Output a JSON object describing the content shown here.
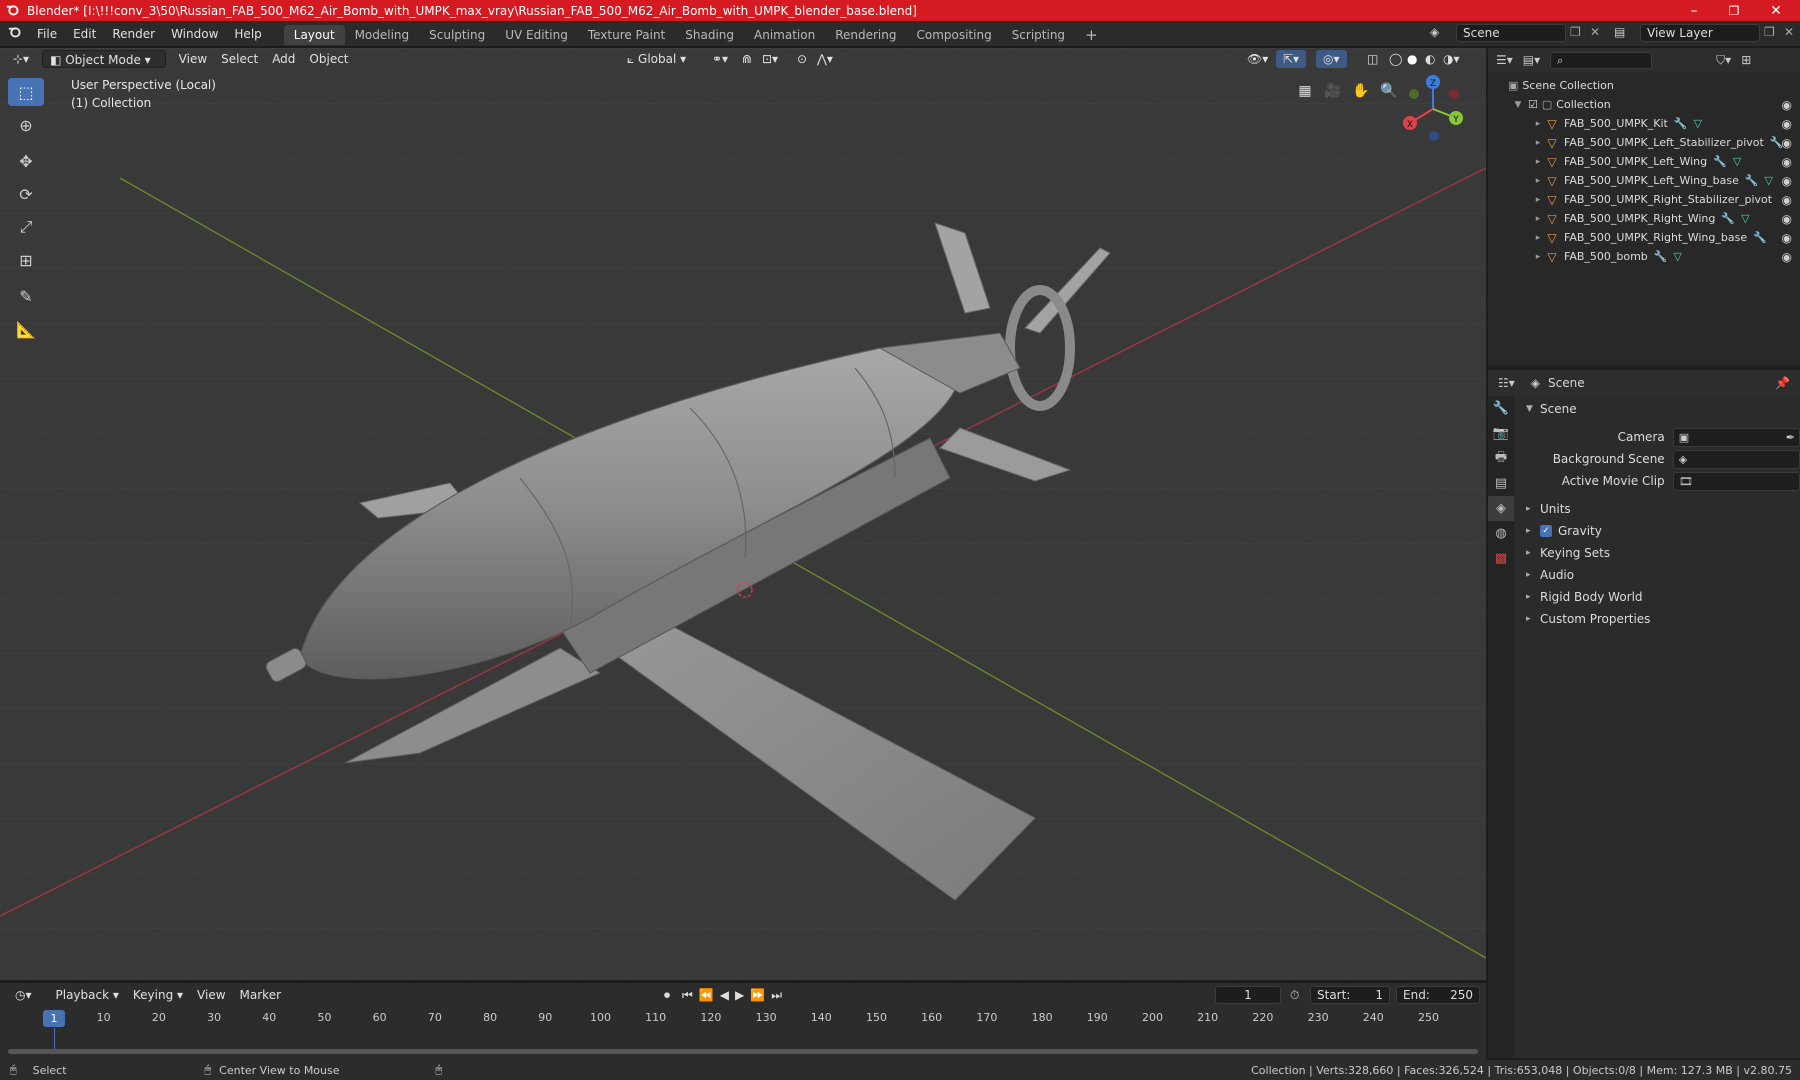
{
  "window": {
    "title": "Blender* [I:\\!!!conv_3\\50\\Russian_FAB_500_M62_Air_Bomb_with_UMPK_max_vray\\Russian_FAB_500_M62_Air_Bomb_with_UMPK_blender_base.blend]",
    "minimize": "–",
    "maximize": "❐",
    "close": "✕"
  },
  "menu": [
    "File",
    "Edit",
    "Render",
    "Window",
    "Help"
  ],
  "workspaces": [
    "Layout",
    "Modeling",
    "Sculpting",
    "UV Editing",
    "Texture Paint",
    "Shading",
    "Animation",
    "Rendering",
    "Compositing",
    "Scripting"
  ],
  "add_workspace": "+",
  "scene_field": "Scene",
  "view_layer_field": "View Layer",
  "viewport": {
    "mode": "Object Mode",
    "menus": [
      "View",
      "Select",
      "Add",
      "Object"
    ],
    "transform_orientation": "Global",
    "perspective_label": "User Perspective (Local)",
    "collection_label": "(1) Collection",
    "gizmo_axes": {
      "z": "Z",
      "x": "X",
      "y": "Y"
    }
  },
  "outliner": {
    "search_placeholder": "",
    "root": "Scene Collection",
    "collection": "Collection",
    "objects": [
      "FAB_500_UMPK_Kit",
      "FAB_500_UMPK_Left_Stabilizer_pivot",
      "FAB_500_UMPK_Left_Wing",
      "FAB_500_UMPK_Left_Wing_base",
      "FAB_500_UMPK_Right_Stabilizer_pivot",
      "FAB_500_UMPK_Right_Wing",
      "FAB_500_UMPK_Right_Wing_base",
      "FAB_500_bomb"
    ]
  },
  "properties": {
    "header": "Scene",
    "section": "Scene",
    "camera_label": "Camera",
    "background_scene_label": "Background Scene",
    "active_movie_clip_label": "Active Movie Clip",
    "subsections": [
      "Units",
      "Gravity",
      "Keying Sets",
      "Audio",
      "Rigid Body World",
      "Custom Properties"
    ]
  },
  "timeline": {
    "menus": [
      "Playback",
      "Keying",
      "View",
      "Marker"
    ],
    "current_frame": "1",
    "start_label": "Start:",
    "start_value": "1",
    "end_label": "End:",
    "end_value": "250",
    "ruler": [
      "1",
      "10",
      "20",
      "30",
      "40",
      "50",
      "60",
      "70",
      "80",
      "90",
      "100",
      "110",
      "120",
      "130",
      "140",
      "150",
      "160",
      "170",
      "180",
      "190",
      "200",
      "210",
      "220",
      "230",
      "240",
      "250"
    ]
  },
  "statusbar": {
    "select": "Select",
    "center_view": "Center View to Mouse",
    "stats": "Collection | Verts:328,660 | Faces:326,524 | Tris:653,048 | Objects:0/8 | Mem: 127.3 MB | v2.80.75"
  },
  "colors": {
    "titlebar": "#d51a22",
    "accent": "#4772b3",
    "x_axis": "#e0424c",
    "y_axis": "#8ac43a",
    "z_axis": "#3d7fe0",
    "object": "#e79b49"
  }
}
